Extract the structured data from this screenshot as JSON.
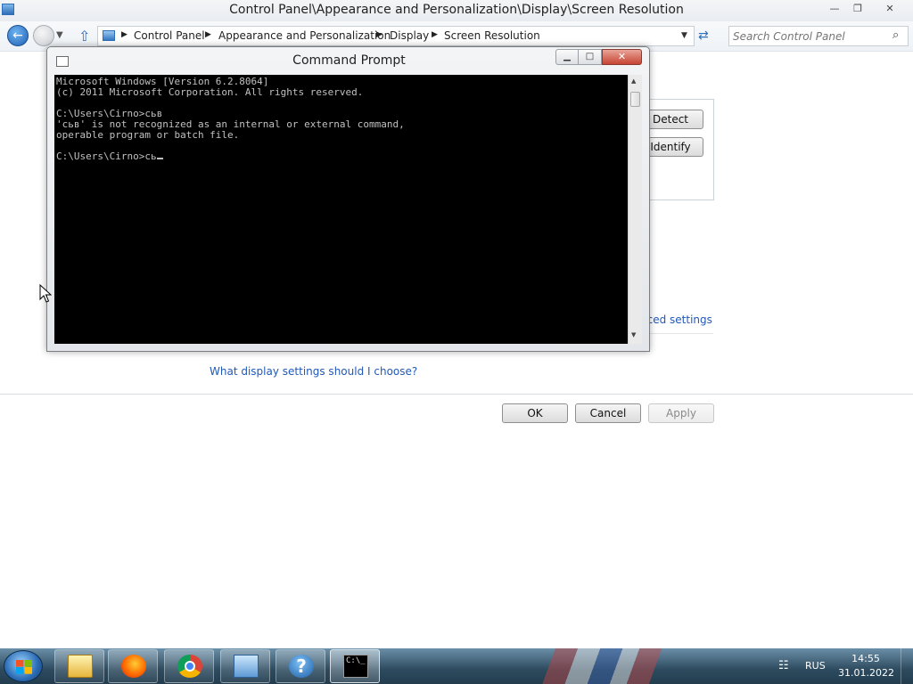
{
  "control_panel": {
    "title": "Control Panel\\Appearance and Personalization\\Display\\Screen Resolution",
    "breadcrumbs": [
      "Control Panel",
      "Appearance and Personalization",
      "Display",
      "Screen Resolution"
    ],
    "search_placeholder": "Search Control Panel",
    "buttons": {
      "detect": "Detect",
      "identify": "Identify",
      "ok": "OK",
      "cancel": "Cancel",
      "apply": "Apply"
    },
    "links": {
      "advanced_settings": "nced settings",
      "display_settings": "What display settings should I choose?"
    }
  },
  "command_prompt": {
    "title": "Command Prompt",
    "lines": [
      "Microsoft Windows [Version 6.2.8064]",
      "(c) 2011 Microsoft Corporation. All rights reserved.",
      "",
      "C:\\Users\\Cirno>сьв",
      "'сьв' is not recognized as an internal or external command,",
      "operable program or batch file.",
      "",
      "C:\\Users\\Cirno>сь"
    ]
  },
  "taskbar": {
    "items": [
      "explorer-icon",
      "firefox-icon",
      "chrome-icon",
      "control-panel-icon",
      "help-icon",
      "cmd-icon"
    ],
    "cmd_icon_text": "C:\\_",
    "help_glyph": "?",
    "language": "RUS",
    "time": "14:55",
    "date": "31.01.2022"
  },
  "colors": {
    "console_background": "#000000",
    "console_text": "#c0c0c0",
    "link": "#2158b8",
    "close_button": "#c74433"
  }
}
